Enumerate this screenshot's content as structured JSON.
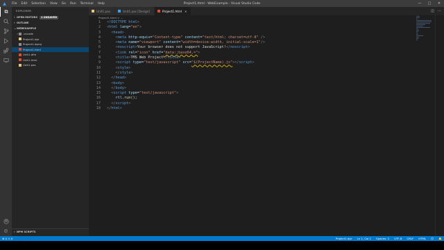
{
  "titlebar": {
    "menu": [
      "File",
      "Edit",
      "Selection",
      "View",
      "Go",
      "Run",
      "Terminal",
      "Help"
    ],
    "title": "Project1.html - WebExample - Visual Studio Code"
  },
  "explorer": {
    "header": "EXPLORER",
    "open_editors_label": "OPEN EDITORS",
    "open_editors_badge": "1 UNSAVED",
    "outline_label": "OUTLINE",
    "workspace_label": "WEBEXAMPLE",
    "files": [
      {
        "name": ".vscode",
        "type": "folder"
      },
      {
        "name": "Project1.dpr",
        "type": "file",
        "color": "#e8c47a"
      },
      {
        "name": "Project1.dproj",
        "type": "file",
        "color": "#8f8f8f"
      },
      {
        "name": "Project1.html",
        "type": "file",
        "color": "#e44d26"
      },
      {
        "name": "Unit1.dfm",
        "type": "file",
        "color": "#e44d26"
      },
      {
        "name": "Unit1.html",
        "type": "file",
        "color": "#e44d26"
      },
      {
        "name": "Unit1.pas",
        "type": "file",
        "color": "#e8c47a"
      }
    ],
    "selected_index": 3,
    "npm_label": "NPM SCRIPTS"
  },
  "tabs": [
    {
      "label": "Unit1.pas",
      "active": false,
      "color": "#e8c47a"
    },
    {
      "label": "Unit1.pas [Design]",
      "active": false,
      "color": "#3aa0f2"
    },
    {
      "label": "Project1.html",
      "active": true,
      "color": "#e44d26"
    }
  ],
  "breadcrumb": "Project1.html > ...",
  "code_lines": [
    {
      "n": "1",
      "segs": [
        [
          "t-punc",
          "<"
        ],
        [
          "t-tag",
          "!DOCTYPE"
        ],
        [
          "t-text",
          " "
        ],
        [
          "t-tag",
          "html"
        ],
        [
          "t-punc",
          ">"
        ]
      ]
    },
    {
      "n": "2",
      "segs": [
        [
          "t-punc",
          "<"
        ],
        [
          "t-tag",
          "html"
        ],
        [
          "t-text",
          " "
        ],
        [
          "t-attr",
          "lang"
        ],
        [
          "t-text",
          "="
        ],
        [
          "t-str",
          "\"en\""
        ],
        [
          "t-punc",
          ">"
        ]
      ]
    },
    {
      "n": "3",
      "segs": [
        [
          "t-text",
          "  "
        ],
        [
          "t-punc",
          "<"
        ],
        [
          "t-tag",
          "head"
        ],
        [
          "t-punc",
          ">"
        ]
      ]
    },
    {
      "n": "4",
      "segs": [
        [
          "t-text",
          "    "
        ],
        [
          "t-punc",
          "<"
        ],
        [
          "t-tag",
          "meta"
        ],
        [
          "t-text",
          " "
        ],
        [
          "t-attr",
          "http-equiv"
        ],
        [
          "t-text",
          "="
        ],
        [
          "t-str",
          "\"Content-type\""
        ],
        [
          "t-text",
          " "
        ],
        [
          "t-attr",
          "content"
        ],
        [
          "t-text",
          "="
        ],
        [
          "t-str",
          "\"text/html; charset=utf-8\""
        ],
        [
          "t-text",
          " "
        ],
        [
          "t-punc",
          "/>"
        ]
      ]
    },
    {
      "n": "5",
      "segs": [
        [
          "t-text",
          "    "
        ],
        [
          "t-punc",
          "<"
        ],
        [
          "t-tag",
          "meta"
        ],
        [
          "t-text",
          " "
        ],
        [
          "t-attr",
          "name"
        ],
        [
          "t-text",
          "="
        ],
        [
          "t-str",
          "\"viewport\""
        ],
        [
          "t-text",
          " "
        ],
        [
          "t-attr",
          "content"
        ],
        [
          "t-text",
          "="
        ],
        [
          "t-str",
          "\"width=device-width, initial-scale=1\""
        ],
        [
          "t-punc",
          "/>"
        ]
      ]
    },
    {
      "n": "6",
      "segs": [
        [
          "t-text",
          "    "
        ],
        [
          "t-punc",
          "<"
        ],
        [
          "t-tag",
          "noscript"
        ],
        [
          "t-punc",
          ">"
        ],
        [
          "t-text",
          "Your browser does not support JavaScript!"
        ],
        [
          "t-punc",
          "</"
        ],
        [
          "t-tag",
          "noscript"
        ],
        [
          "t-punc",
          ">"
        ]
      ]
    },
    {
      "n": "7",
      "segs": [
        [
          "t-text",
          "    "
        ],
        [
          "t-punc",
          "<"
        ],
        [
          "t-tag",
          "link"
        ],
        [
          "t-text",
          " "
        ],
        [
          "t-attr",
          "rel"
        ],
        [
          "t-text",
          "="
        ],
        [
          "t-str",
          "\"icon\""
        ],
        [
          "t-text",
          " "
        ],
        [
          "t-attr",
          "href"
        ],
        [
          "t-text",
          "="
        ],
        [
          "t-str",
          "\"data:;base64,=\""
        ],
        [
          "t-punc",
          ">"
        ]
      ]
    },
    {
      "n": "8",
      "segs": [
        [
          "t-text",
          "    "
        ],
        [
          "t-punc",
          "<"
        ],
        [
          "t-tag",
          "title"
        ],
        [
          "t-punc",
          ">"
        ],
        [
          "t-text",
          "TMS Web Project"
        ],
        [
          "t-punc",
          "</"
        ],
        [
          "t-tag",
          "title"
        ],
        [
          "t-punc",
          ">"
        ]
      ]
    },
    {
      "n": "9",
      "segs": [
        [
          "t-text",
          "    "
        ],
        [
          "t-punc",
          "<"
        ],
        [
          "t-tag",
          "script"
        ],
        [
          "t-text",
          " "
        ],
        [
          "t-attr",
          "type"
        ],
        [
          "t-text",
          "="
        ],
        [
          "t-str",
          "\"text/javascript\""
        ],
        [
          "t-text",
          " "
        ],
        [
          "t-attr",
          "src"
        ],
        [
          "t-text",
          "="
        ],
        [
          "t-str",
          "\"$(ProjectName).js\""
        ],
        [
          "t-punc",
          "></"
        ],
        [
          "t-tag",
          "script"
        ],
        [
          "t-punc",
          ">"
        ]
      ]
    },
    {
      "n": "10",
      "segs": [
        [
          "t-text",
          "    "
        ],
        [
          "t-punc",
          "<"
        ],
        [
          "t-tag",
          "style"
        ],
        [
          "t-punc",
          ">"
        ]
      ]
    },
    {
      "n": "11",
      "segs": [
        [
          "t-text",
          "    "
        ],
        [
          "t-punc",
          "</"
        ],
        [
          "t-tag",
          "style"
        ],
        [
          "t-punc",
          ">"
        ]
      ]
    },
    {
      "n": "12",
      "segs": [
        [
          "t-text",
          "  "
        ],
        [
          "t-punc",
          "</"
        ],
        [
          "t-tag",
          "head"
        ],
        [
          "t-punc",
          ">"
        ]
      ]
    },
    {
      "n": "13",
      "segs": [
        [
          "t-text",
          "  "
        ],
        [
          "t-punc",
          "<"
        ],
        [
          "t-tag",
          "body"
        ],
        [
          "t-punc",
          ">"
        ]
      ]
    },
    {
      "n": "14",
      "segs": [
        [
          "t-text",
          "  "
        ],
        [
          "t-punc",
          "</"
        ],
        [
          "t-tag",
          "body"
        ],
        [
          "t-punc",
          ">"
        ]
      ]
    },
    {
      "n": "15",
      "segs": [
        [
          "t-text",
          "  "
        ],
        [
          "t-punc",
          "<"
        ],
        [
          "t-tag",
          "script"
        ],
        [
          "t-text",
          " "
        ],
        [
          "t-attr",
          "type"
        ],
        [
          "t-text",
          "="
        ],
        [
          "t-str",
          "\"text/javascript\""
        ],
        [
          "t-punc",
          ">"
        ]
      ]
    },
    {
      "n": "16",
      "segs": [
        [
          "t-text",
          "    "
        ],
        [
          "t-var",
          "rtl"
        ],
        [
          "t-text",
          "."
        ],
        [
          "t-fn",
          "run"
        ],
        [
          "t-text",
          "();"
        ]
      ]
    },
    {
      "n": "17",
      "segs": [
        [
          "t-text",
          "  "
        ],
        [
          "t-punc",
          "</"
        ],
        [
          "t-tag",
          "script"
        ],
        [
          "t-punc",
          ">"
        ]
      ]
    },
    {
      "n": "18",
      "segs": [
        [
          "t-punc",
          "</"
        ],
        [
          "t-tag",
          "html"
        ],
        [
          "t-punc",
          ">"
        ]
      ]
    }
  ],
  "status": {
    "errors": "0",
    "warnings": "0",
    "project": "Project1.dpr",
    "cursor": "Ln 1, Col 1",
    "spaces": "Spaces: 2",
    "encoding": "UTF-8",
    "eol": "CRLF",
    "language": "HTML"
  },
  "colors": {
    "accent": "#007acc",
    "selection": "#094771",
    "html_icon": "#e44d26"
  }
}
